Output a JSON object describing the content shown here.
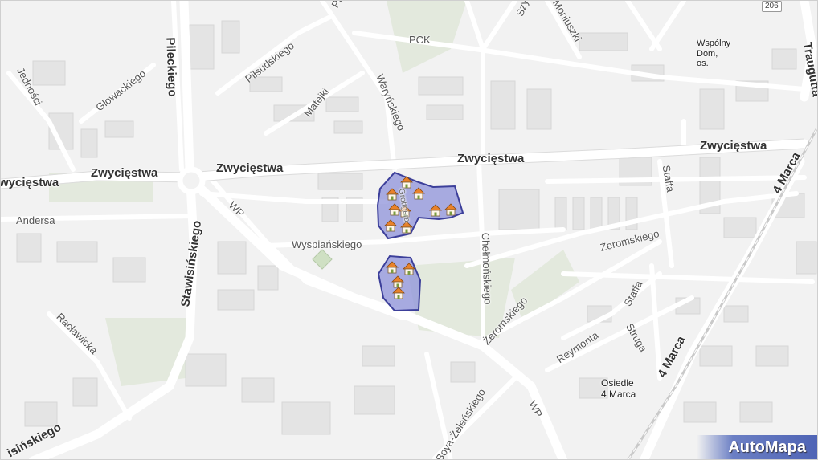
{
  "map": {
    "brand": "AutoMapa",
    "accent_color": "#8e91d9",
    "icon": "house-icon",
    "labels": {
      "zwyciestwa_w": "wycięstwa",
      "zwyciestwa_1": "Zwycięstwa",
      "zwyciestwa_2": "Zwycięstwa",
      "zwyciestwa_3": "Zwycięstwa",
      "zwyciestwa_4": "Zwycięstwa",
      "pilsudskiego": "Piłsudskiego",
      "pilsudzkiego_top": "Pi",
      "pck": "PCK",
      "matejki": "Matejki",
      "warynskiego": "Waryńskiego",
      "jednosci": "Jedności",
      "glowackiego": "Głowackiego",
      "pileckiego": "Pileckiego",
      "szy": "Szy",
      "moniuszki": "Moniuszki",
      "shield_206": "206",
      "wspolny_dom": "Wspólny\nDom,\nos.",
      "traugutta": "Traugutta",
      "marca_1": "4 Marca",
      "marca_2": "4 Marca",
      "staffa_1": "Staffa",
      "staffa_2": "Staffa",
      "andersa": "Andersa",
      "wp_1": "WP",
      "wp_2": "WP",
      "wyspianskiego": "Wyspiańskiego",
      "stawisinskiego_1": "Stawisińskiego",
      "stawisinskiego_2": "isińskiego",
      "chelmonskiego": "Chełmońskiego",
      "zeromskiego_1": "Żeromskiego",
      "zeromskiego_2": "Żeromskiego",
      "reymonta": "Reymonta",
      "struga": "Struga",
      "osiedle": "Osiedle\n4 Marca",
      "raclawicka": "Racławicka",
      "zelenskiego": "Boya-Żeleńskiego",
      "grottgera": "Grottgera"
    }
  }
}
